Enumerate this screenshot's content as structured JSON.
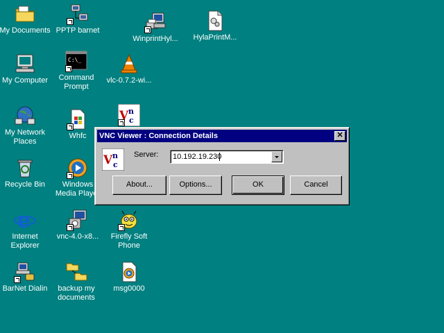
{
  "desktop": {
    "background_color": "#008080",
    "icons": [
      {
        "label": "My Documents",
        "icon": "folder-documents-icon"
      },
      {
        "label": "PPTP barnet",
        "icon": "network-connection-icon"
      },
      {
        "label": "WinprintHyl...",
        "icon": "printer-computer-icon"
      },
      {
        "label": "HylaPrintM...",
        "icon": "config-file-icon"
      },
      {
        "label": "My Computer",
        "icon": "computer-icon"
      },
      {
        "label": "Command\nPrompt",
        "icon": "command-prompt-icon"
      },
      {
        "label": "vlc-0.7.2-wi...",
        "icon": "vlc-cone-icon"
      },
      {
        "label": "My Network\nPlaces",
        "icon": "network-places-icon"
      },
      {
        "label": "Whfc",
        "icon": "whfc-icon"
      },
      {
        "label": "Recycle Bin",
        "icon": "recycle-bin-icon"
      },
      {
        "label": "Windows\nMedia Player",
        "icon": "media-player-icon"
      },
      {
        "label": "Internet\nExplorer",
        "icon": "internet-explorer-icon"
      },
      {
        "label": "vnc-4.0-x8...",
        "icon": "vnc-installer-icon"
      },
      {
        "label": "Firefly Soft\nPhone",
        "icon": "firefly-phone-icon"
      },
      {
        "label": "BarNet Dialin",
        "icon": "dialin-icon"
      },
      {
        "label": "backup my\ndocuments",
        "icon": "folder-backup-icon"
      },
      {
        "label": "msg0000",
        "icon": "media-file-icon"
      }
    ]
  },
  "dialog": {
    "title": "VNC Viewer : Connection Details",
    "server_label": "Server:",
    "server_value": "10.192.19.230",
    "buttons": {
      "about": "About...",
      "options": "Options...",
      "ok": "OK",
      "cancel": "Cancel"
    },
    "colors": {
      "titlebar": "#000080",
      "face": "#c0c0c0"
    }
  }
}
